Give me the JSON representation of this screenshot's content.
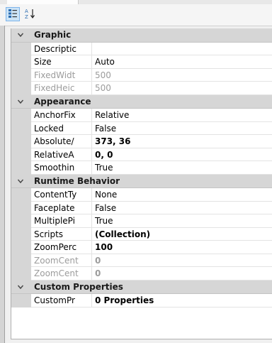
{
  "toolbar": {
    "categorized_icon": "categorized-view-icon",
    "alphabetical_icon": "alphabetical-sort-icon"
  },
  "colors": {
    "category_bg": "#d6d6d6",
    "disabled_text": "#9c9c9c",
    "selected_button_bg": "#cce4f7"
  },
  "categories": [
    {
      "name": "Graphic",
      "properties": [
        {
          "name": "Descriptic",
          "value": "",
          "bold": false,
          "disabled": false
        },
        {
          "name": "Size",
          "value": "Auto",
          "bold": false,
          "disabled": false
        },
        {
          "name": "FixedWidt",
          "value": "500",
          "bold": false,
          "disabled": true
        },
        {
          "name": "FixedHeic",
          "value": "500",
          "bold": false,
          "disabled": true
        }
      ]
    },
    {
      "name": "Appearance",
      "properties": [
        {
          "name": "AnchorFix",
          "value": "Relative",
          "bold": false,
          "disabled": false
        },
        {
          "name": "Locked",
          "value": "False",
          "bold": false,
          "disabled": false
        },
        {
          "name": "Absolute/",
          "value": "373, 36",
          "bold": true,
          "disabled": false
        },
        {
          "name": "RelativeA",
          "value": "0, 0",
          "bold": true,
          "disabled": false
        },
        {
          "name": "Smoothin",
          "value": "True",
          "bold": false,
          "disabled": false
        }
      ]
    },
    {
      "name": "Runtime Behavior",
      "properties": [
        {
          "name": "ContentTy",
          "value": "None",
          "bold": false,
          "disabled": false
        },
        {
          "name": "Faceplate",
          "value": "False",
          "bold": false,
          "disabled": false
        },
        {
          "name": "MultiplePi",
          "value": "True",
          "bold": false,
          "disabled": false
        },
        {
          "name": "Scripts",
          "value": "(Collection)",
          "bold": true,
          "disabled": false
        },
        {
          "name": "ZoomPerc",
          "value": "100",
          "bold": true,
          "disabled": false
        },
        {
          "name": "ZoomCent",
          "value": "0",
          "bold": true,
          "disabled": true
        },
        {
          "name": "ZoomCent",
          "value": "0",
          "bold": true,
          "disabled": true
        }
      ]
    },
    {
      "name": "Custom Properties",
      "properties": [
        {
          "name": "CustomPr",
          "value": "0 Properties",
          "bold": true,
          "disabled": false
        }
      ]
    }
  ]
}
